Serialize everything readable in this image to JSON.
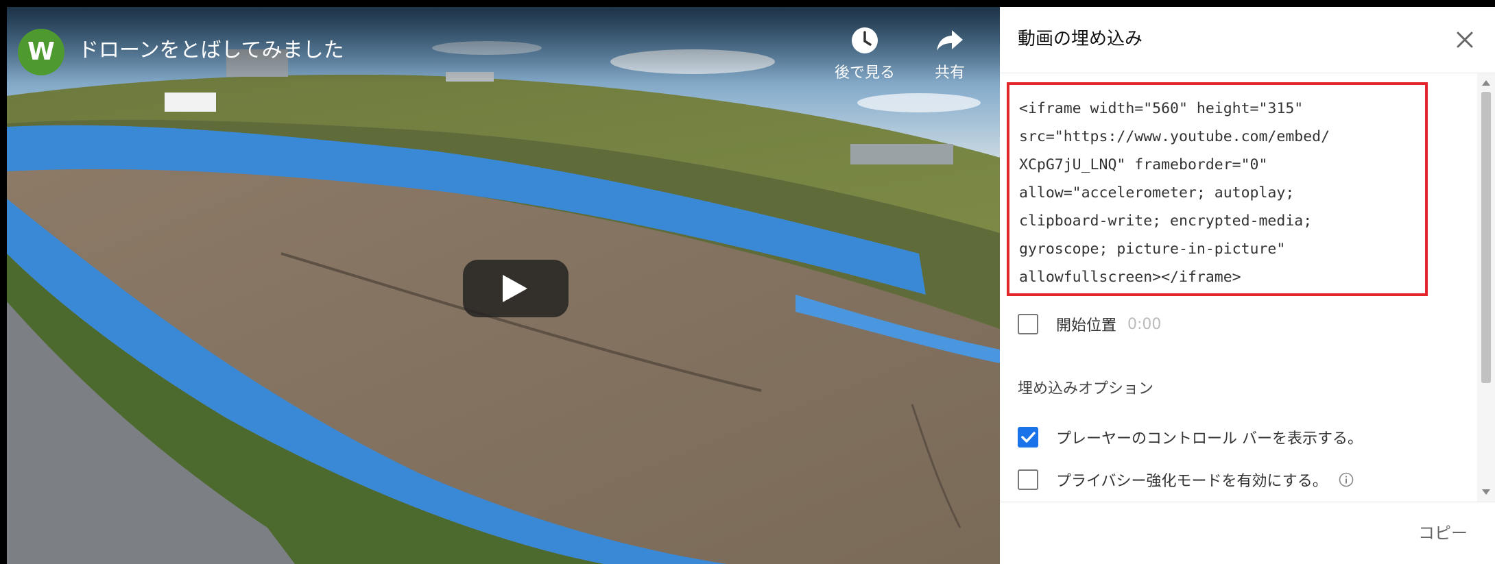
{
  "video": {
    "channel_initial": "W",
    "title": "ドローンをとばしてみました",
    "actions": {
      "watch_later": {
        "label": "後で見る",
        "icon": "clock-icon"
      },
      "share": {
        "label": "共有",
        "icon": "share-arrow-icon"
      }
    },
    "play_icon": "play-icon"
  },
  "embed_panel": {
    "title": "動画の埋め込み",
    "close_icon": "close-icon",
    "embed_code": "<iframe width=\"560\" height=\"315\"\nsrc=\"https://www.youtube.com/embed/\nXCpG7jU_LNQ\" frameborder=\"0\"\nallow=\"accelerometer; autoplay;\nclipboard-write; encrypted-media;\ngyroscope; picture-in-picture\"\nallowfullscreen></iframe>",
    "start_time": {
      "label": "開始位置",
      "value": "0:00",
      "checked": false
    },
    "options_title": "埋め込みオプション",
    "options": [
      {
        "label": "プレーヤーのコントロール バーを表示する。",
        "checked": true
      },
      {
        "label": "プライバシー強化モードを有効にする。",
        "checked": false,
        "icon": "info-icon"
      }
    ],
    "copy_label": "コピー"
  },
  "colors": {
    "highlight_border": "#e3262c",
    "checkbox_checked": "#1a73e8",
    "avatar": "#4e9a2f"
  }
}
